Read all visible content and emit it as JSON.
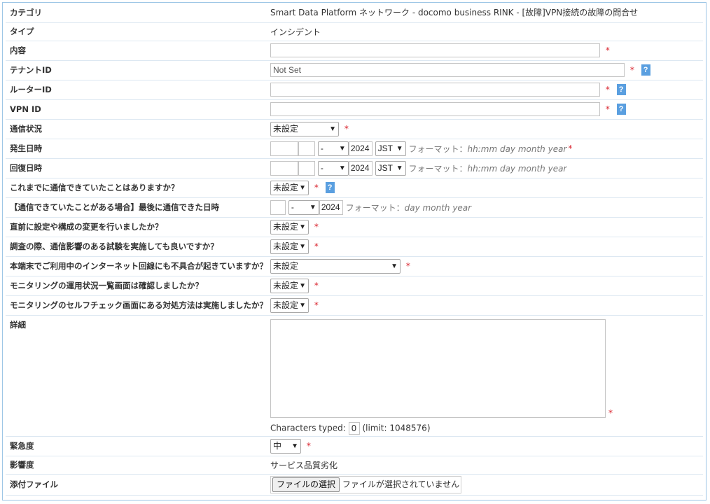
{
  "category": {
    "label": "カテゴリ",
    "value": "Smart Data Platform ネットワーク - docomo business RINK - [故障]VPN接続の故障の問合せ"
  },
  "type": {
    "label": "タイプ",
    "value": "インシデント"
  },
  "content": {
    "label": "内容",
    "value": ""
  },
  "tenant": {
    "label": "テナントID",
    "value": "Not Set"
  },
  "router": {
    "label": "ルーターID",
    "value": ""
  },
  "vpn": {
    "label": "VPN ID",
    "value": ""
  },
  "comm_status": {
    "label": "通信状況",
    "selected": "未設定"
  },
  "occur": {
    "label": "発生日時",
    "day": "-",
    "year": "2024",
    "tz": "JST",
    "format_prefix": "フォーマット：",
    "format_value": "hh:mm day month year"
  },
  "recover": {
    "label": "回復日時",
    "day": "-",
    "year": "2024",
    "tz": "JST",
    "format_prefix": "フォーマット：",
    "format_value": "hh:mm day month year"
  },
  "q_prev_comm": {
    "label": "これまでに通信できていたことはありますか？",
    "selected": "未設定"
  },
  "last_comm": {
    "label": "【通信できていたことがある場合】最後に通信できた日時",
    "month": "-",
    "year": "2024",
    "format_prefix": "フォーマット：",
    "format_value": "day month year"
  },
  "q_config_change": {
    "label": "直前に設定や構成の変更を行いましたか？",
    "selected": "未設定"
  },
  "q_test_ok": {
    "label": "調査の際、通信影響のある試験を実施しても良いですか？",
    "selected": "未設定"
  },
  "q_internet": {
    "label": "本端末でご利用中のインターネット回線にも不具合が起きていますか？",
    "selected": "未設定"
  },
  "q_monitor_list": {
    "label": "モニタリングの運用状況一覧画面は確認しましたか？",
    "selected": "未設定"
  },
  "q_selfcheck": {
    "label": "モニタリングのセルフチェック画面にある対処方法は実施しましたか？",
    "selected": "未設定"
  },
  "detail": {
    "label": "詳細",
    "value": "",
    "chars_prefix": "Characters typed:",
    "chars_count": "0",
    "chars_limit": "(limit: 1048576)"
  },
  "urgency": {
    "label": "緊急度",
    "selected": "中"
  },
  "impact": {
    "label": "影響度",
    "value": "サービス品質劣化"
  },
  "attachment": {
    "label": "添付ファイル",
    "button": "ファイルの選択",
    "status": "ファイルが選択されていません"
  },
  "common": {
    "required": "*",
    "help": "?"
  }
}
